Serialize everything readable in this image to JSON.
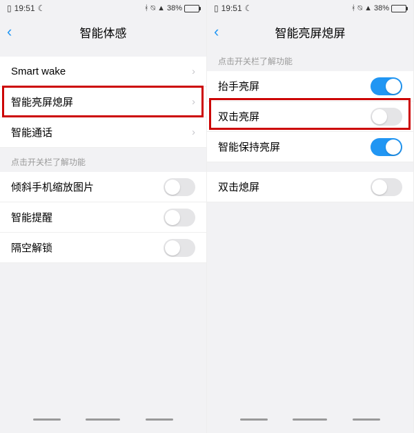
{
  "left": {
    "status": {
      "time": "19:51",
      "battery_pct": "38%"
    },
    "header_title": "智能体感",
    "rows_nav": [
      {
        "label": "Smart wake"
      },
      {
        "label": "智能亮屏熄屏"
      },
      {
        "label": "智能通话"
      }
    ],
    "section_hint": "点击开关栏了解功能",
    "rows_toggle": [
      {
        "label": "倾斜手机缩放图片",
        "on": false
      },
      {
        "label": "智能提醒",
        "on": false
      },
      {
        "label": "隔空解锁",
        "on": false
      }
    ]
  },
  "right": {
    "status": {
      "time": "19:51",
      "battery_pct": "38%"
    },
    "header_title": "智能亮屏熄屏",
    "section_hint": "点击开关栏了解功能",
    "group1": [
      {
        "label": "抬手亮屏",
        "on": true
      },
      {
        "label": "双击亮屏",
        "on": false
      },
      {
        "label": "智能保持亮屏",
        "on": true
      }
    ],
    "group2": [
      {
        "label": "双击熄屏",
        "on": false
      }
    ]
  }
}
